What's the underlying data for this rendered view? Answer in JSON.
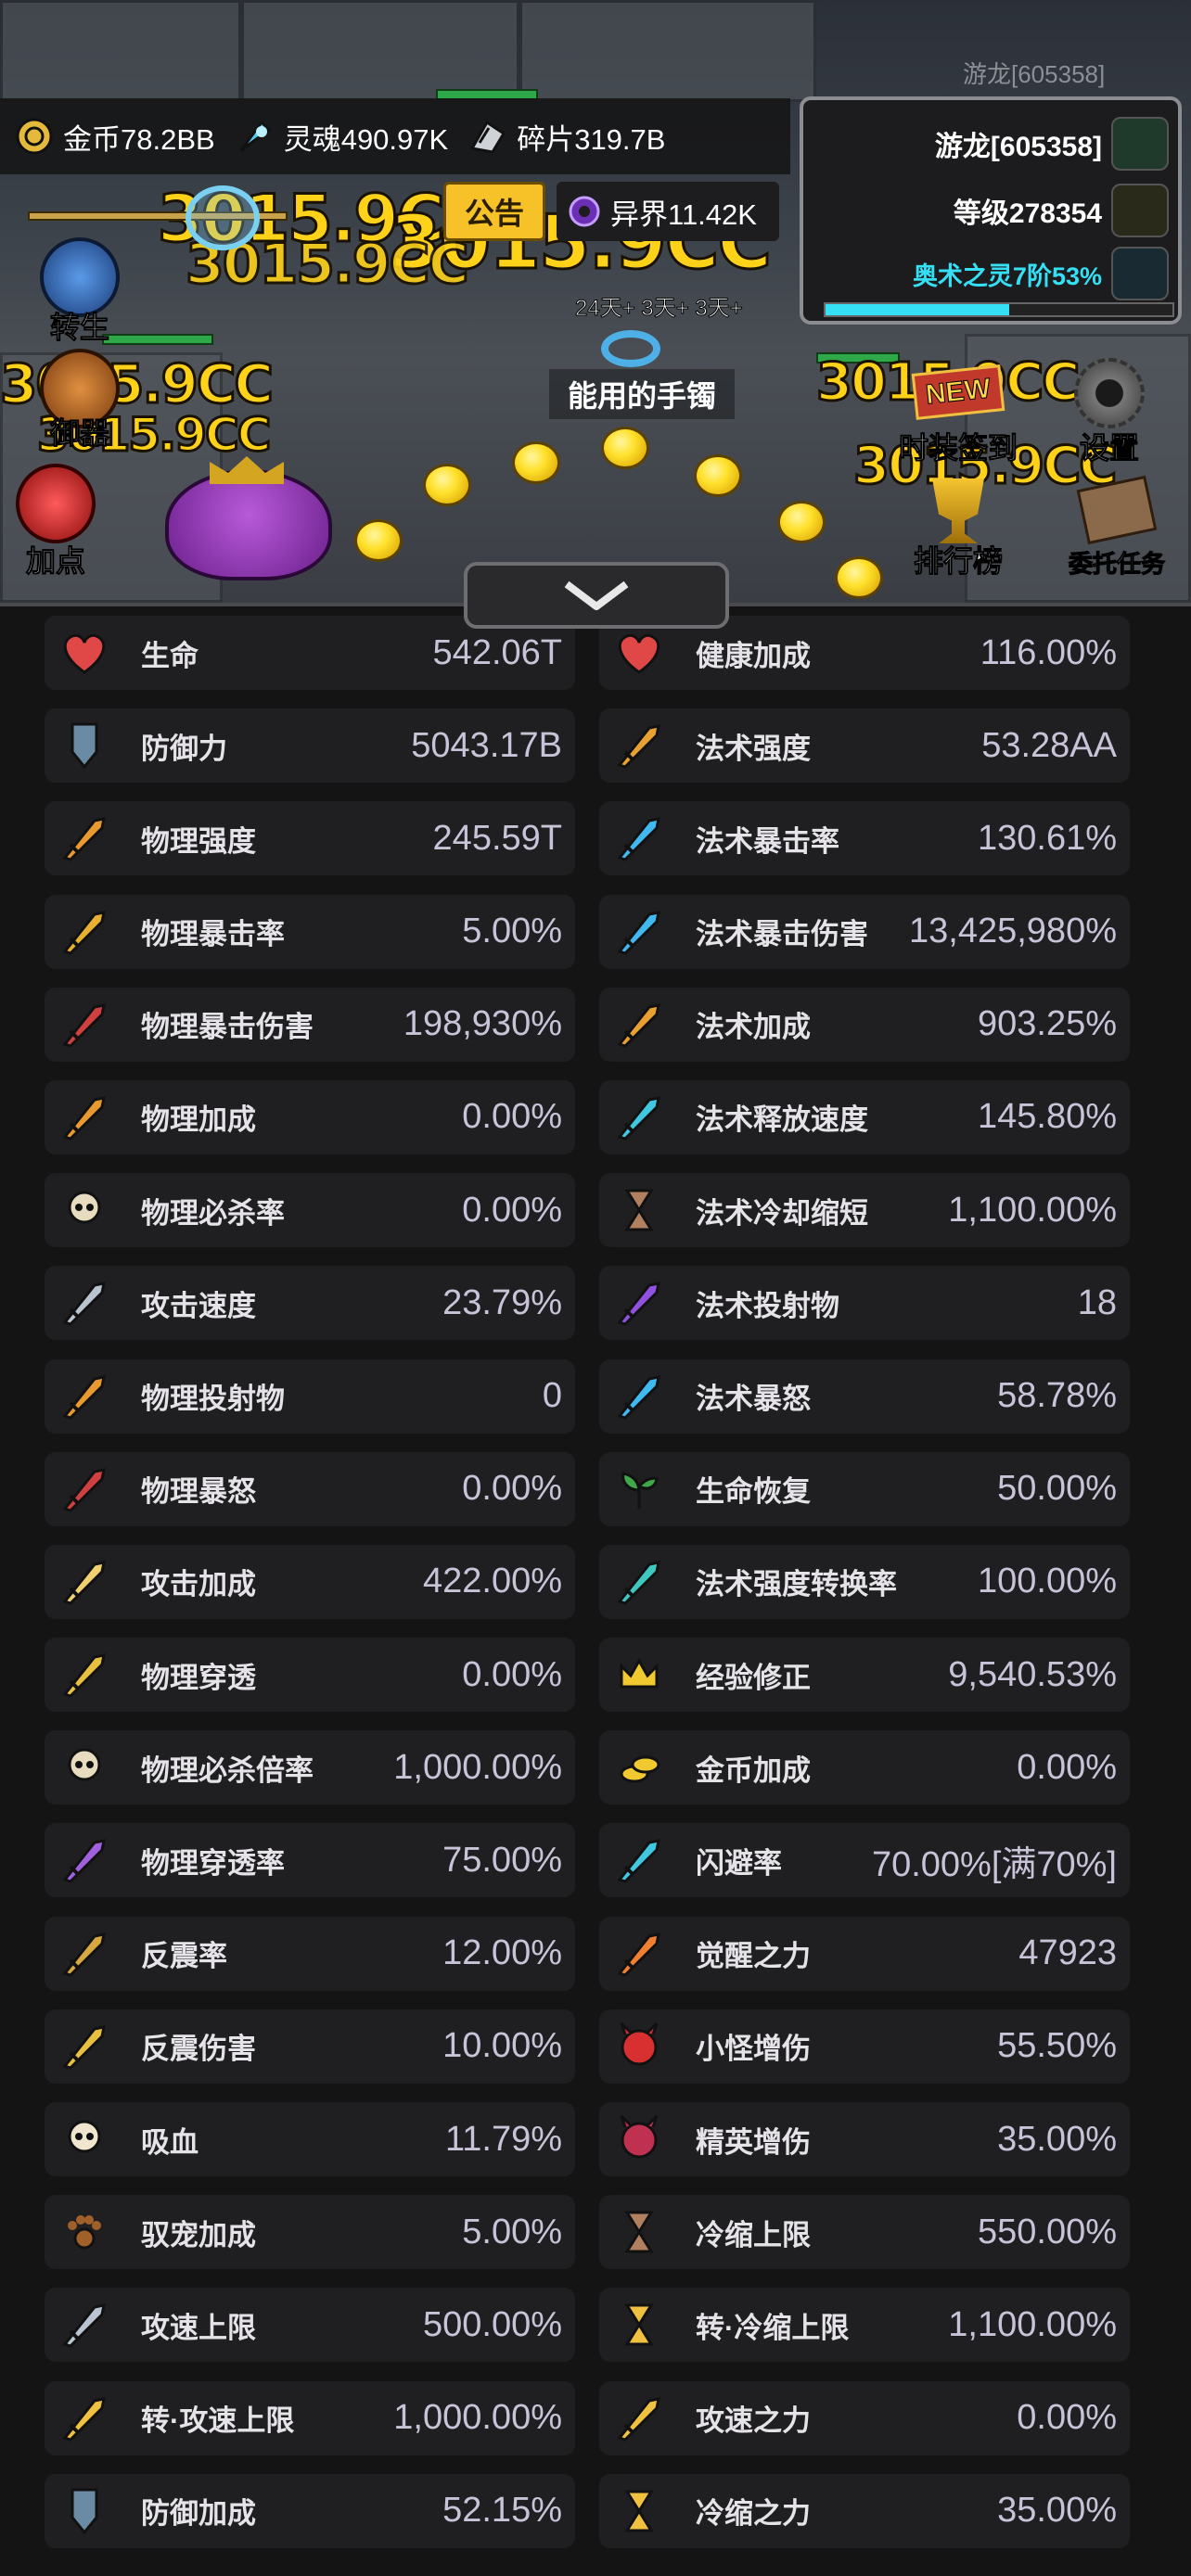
{
  "currency": {
    "gold": "金币78.2BB",
    "soul": "灵魂490.97K",
    "shard": "碎片319.7B"
  },
  "scene": {
    "watermark": "游龙[605358]",
    "notice": "公告",
    "otherworld": "异界11.42K",
    "damage_text": "3015.9CC",
    "loot_timer": "24天+ 3天+ 3天+",
    "loot_name": "能用的手镯"
  },
  "player": {
    "name": "游龙[605358]",
    "level": "等级278354",
    "soul_stage": "奥术之灵7阶53%",
    "soul_progress": 0.53
  },
  "side_buttons": {
    "rebirth": "转生",
    "weapon": "御器",
    "points": "加点",
    "fashion_signin": "时装签到",
    "fashion_badge": "NEW",
    "settings": "设置",
    "ranking": "排行榜",
    "commission": "委托任务"
  },
  "stats_left": [
    {
      "label": "生命",
      "value": "542.06T",
      "icon": "heart-icon"
    },
    {
      "label": "防御力",
      "value": "5043.17B",
      "icon": "shield-icon"
    },
    {
      "label": "物理强度",
      "value": "245.59T",
      "icon": "sword-icon"
    },
    {
      "label": "物理暴击率",
      "value": "5.00%",
      "icon": "crit-icon"
    },
    {
      "label": "物理暴击伤害",
      "value": "198,930%",
      "icon": "crit-damage-icon"
    },
    {
      "label": "物理加成",
      "value": "0.00%",
      "icon": "sword-plus-icon"
    },
    {
      "label": "物理必杀率",
      "value": "0.00%",
      "icon": "skull-icon"
    },
    {
      "label": "攻击速度",
      "value": "23.79%",
      "icon": "attack-speed-icon"
    },
    {
      "label": "物理投射物",
      "value": "0",
      "icon": "projectile-icon"
    },
    {
      "label": "物理暴怒",
      "value": "0.00%",
      "icon": "rage-icon"
    },
    {
      "label": "攻击加成",
      "value": "422.00%",
      "icon": "crossed-swords-icon"
    },
    {
      "label": "物理穿透",
      "value": "0.00%",
      "icon": "pierce-icon"
    },
    {
      "label": "物理必杀倍率",
      "value": "1,000.00%",
      "icon": "skull-icon"
    },
    {
      "label": "物理穿透率",
      "value": "75.00%",
      "icon": "pierce-rate-icon"
    },
    {
      "label": "反震率",
      "value": "12.00%",
      "icon": "reflect-icon"
    },
    {
      "label": "反震伤害",
      "value": "10.00%",
      "icon": "reflect-damage-icon"
    },
    {
      "label": "吸血",
      "value": "11.79%",
      "icon": "vampire-icon"
    },
    {
      "label": "驭宠加成",
      "value": "5.00%",
      "icon": "paw-icon"
    },
    {
      "label": "攻速上限",
      "value": "500.00%",
      "icon": "speed-cap-icon"
    },
    {
      "label": "转·攻速上限",
      "value": "1,000.00%",
      "icon": "speed-cap-plus-icon"
    },
    {
      "label": "防御加成",
      "value": "52.15%",
      "icon": "shield-plus-icon"
    }
  ],
  "stats_right": [
    {
      "label": "健康加成",
      "value": "116.00%",
      "icon": "heart-plus-icon"
    },
    {
      "label": "法术强度",
      "value": "53.28AA",
      "icon": "spell-icon"
    },
    {
      "label": "法术暴击率",
      "value": "130.61%",
      "icon": "spell-crit-icon"
    },
    {
      "label": "法术暴击伤害",
      "value": "13,425,980%",
      "icon": "spell-crit-damage-icon"
    },
    {
      "label": "法术加成",
      "value": "903.25%",
      "icon": "spell-plus-icon"
    },
    {
      "label": "法术释放速度",
      "value": "145.80%",
      "icon": "cast-speed-icon"
    },
    {
      "label": "法术冷却缩短",
      "value": "1,100.00%",
      "icon": "hourglass-icon"
    },
    {
      "label": "法术投射物",
      "value": "18",
      "icon": "spell-projectile-icon"
    },
    {
      "label": "法术暴怒",
      "value": "58.78%",
      "icon": "spell-rage-icon"
    },
    {
      "label": "生命恢复",
      "value": "50.00%",
      "icon": "sprout-icon"
    },
    {
      "label": "法术强度转换率",
      "value": "100.00%",
      "icon": "conversion-icon"
    },
    {
      "label": "经验修正",
      "value": "9,540.53%",
      "icon": "crown-icon"
    },
    {
      "label": "金币加成",
      "value": "0.00%",
      "icon": "coins-icon"
    },
    {
      "label": "闪避率",
      "value": "70.00%[满70%]",
      "icon": "dodge-icon"
    },
    {
      "label": "觉醒之力",
      "value": "47923",
      "icon": "awaken-icon"
    },
    {
      "label": "小怪增伤",
      "value": "55.50%",
      "icon": "demon-icon"
    },
    {
      "label": "精英增伤",
      "value": "35.00%",
      "icon": "elite-icon"
    },
    {
      "label": "冷缩上限",
      "value": "550.00%",
      "icon": "hourglass-cap-icon"
    },
    {
      "label": "转·冷缩上限",
      "value": "1,100.00%",
      "icon": "hourglass-cap-plus-icon"
    },
    {
      "label": "攻速之力",
      "value": "0.00%",
      "icon": "speed-power-icon"
    },
    {
      "label": "冷缩之力",
      "value": "35.00%",
      "icon": "cooldown-power-icon"
    }
  ]
}
